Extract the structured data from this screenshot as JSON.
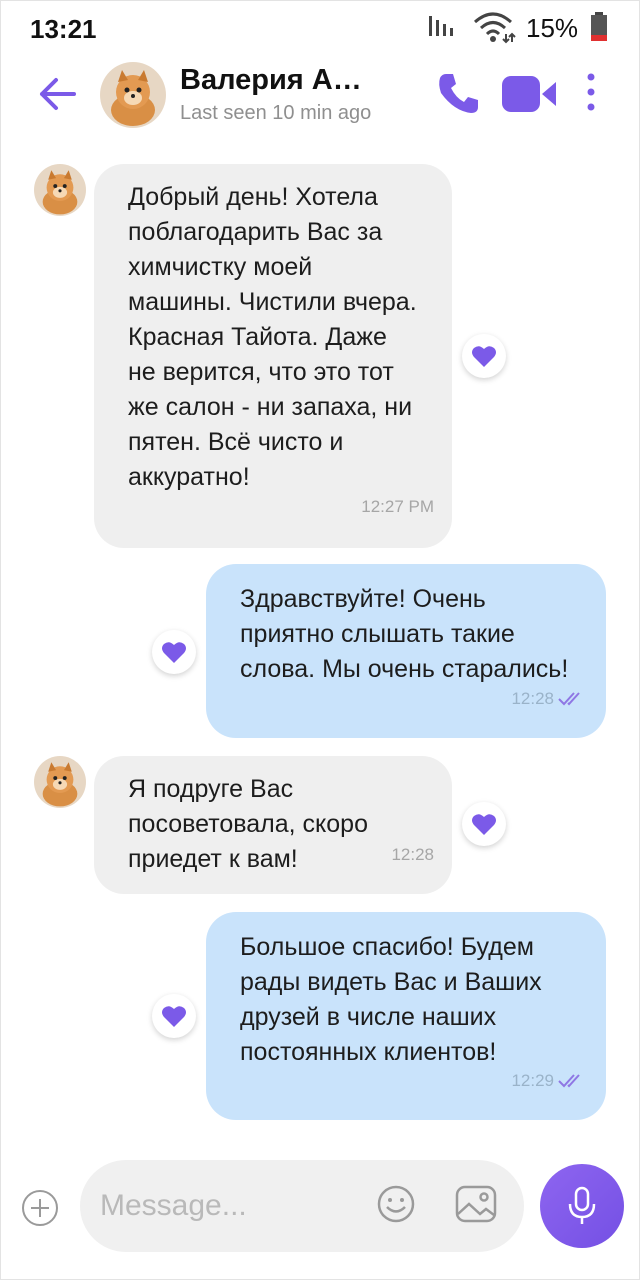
{
  "status_bar": {
    "time": "13:21",
    "battery": "15%"
  },
  "header": {
    "name": "Валерия А…",
    "last_seen": "Last seen 10 min ago"
  },
  "messages": [
    {
      "direction": "in",
      "text": "Добрый день! Хотела поблагодарить Вас за химчистку моей машины. Чистили вчера. Красная Тайота. Даже не верится, что это тот же салон - ни запаха, ни пятен. Всё чисто и аккуратно!",
      "time": "12:27 PM",
      "liked": true
    },
    {
      "direction": "out",
      "text": "Здравствуйте! Очень приятно слышать такие слова. Мы очень старались!",
      "time": "12:28",
      "liked": true
    },
    {
      "direction": "in",
      "text": "Я подруге Вас посоветовала, скоро приедет к вам!",
      "time": "12:28",
      "liked": true
    },
    {
      "direction": "out",
      "text": "Большое спасибо! Будем рады видеть Вас и Ваших друзей в числе наших постоянных клиентов!",
      "time": "12:29",
      "liked": true
    }
  ],
  "composer": {
    "placeholder": "Message..."
  },
  "colors": {
    "accent": "#7b5ae8",
    "incoming_bubble": "#efefef",
    "outgoing_bubble": "#c9e3fb"
  },
  "icons": [
    "back-arrow-icon",
    "phone-icon",
    "video-camera-icon",
    "more-vertical-icon",
    "heart-icon",
    "double-check-icon",
    "plus-icon",
    "emoji-icon",
    "gallery-icon",
    "microphone-icon"
  ]
}
